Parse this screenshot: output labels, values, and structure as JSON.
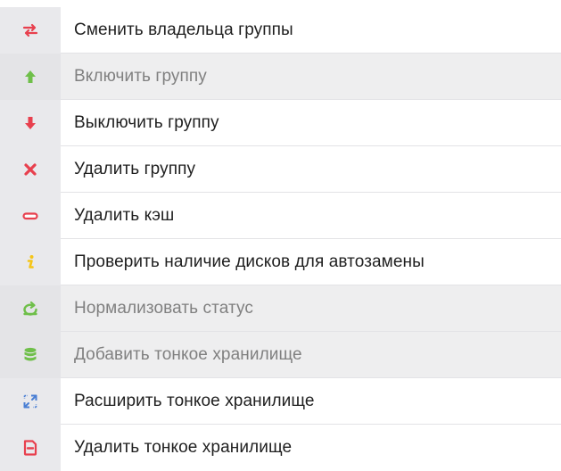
{
  "colors": {
    "red": "#e8404e",
    "green": "#6fbf4a",
    "yellow": "#f5c518",
    "blue": "#4a7fd4",
    "gutter": "#e9e9ec"
  },
  "menu": {
    "items": [
      {
        "label": "Сменить владельца группы",
        "icon": "swap-arrows-icon",
        "enabled": true
      },
      {
        "label": "Включить группу",
        "icon": "arrow-up-icon",
        "enabled": false
      },
      {
        "label": "Выключить группу",
        "icon": "arrow-down-icon",
        "enabled": true
      },
      {
        "label": "Удалить группу",
        "icon": "close-icon",
        "enabled": true
      },
      {
        "label": "Удалить кэш",
        "icon": "minus-pill-icon",
        "enabled": true
      },
      {
        "label": "Проверить наличие дисков для автозамены",
        "icon": "info-icon",
        "enabled": true
      },
      {
        "label": "Нормализовать статус",
        "icon": "refresh-icon",
        "enabled": false
      },
      {
        "label": "Добавить тонкое хранилище",
        "icon": "database-icon",
        "enabled": false
      },
      {
        "label": "Расширить тонкое хранилище",
        "icon": "expand-icon",
        "enabled": true
      },
      {
        "label": "Удалить тонкое хранилище",
        "icon": "remove-storage-icon",
        "enabled": true
      }
    ]
  }
}
